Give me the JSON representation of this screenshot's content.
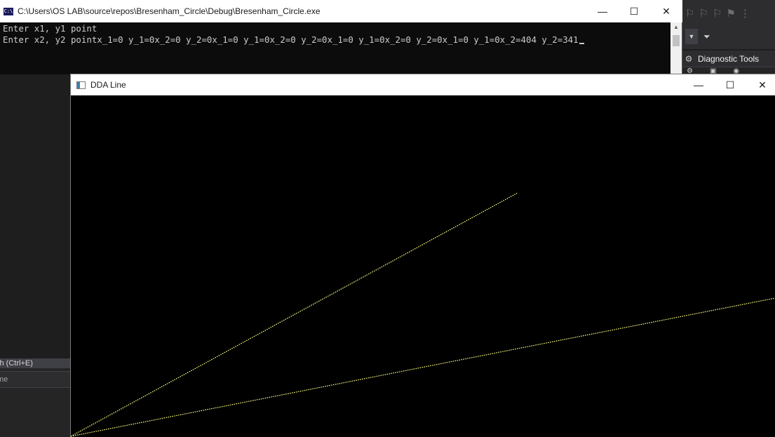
{
  "console_window": {
    "title": "C:\\Users\\OS LAB\\source\\repos\\Bresenham_Circle\\Debug\\Bresenham_Circle.exe",
    "icon_text": "C:\\",
    "lines": [
      "Enter x1, y1 point",
      "Enter x2, y2 pointx_1=0 y_1=0x_2=0 y_2=0x_1=0 y_1=0x_2=0 y_2=0x_1=0 y_1=0x_2=0 y_2=0x_1=0 y_1=0x_2=404 y_2=341"
    ],
    "minimize": "—",
    "maximize": "☐",
    "close": "✕"
  },
  "graphics_window": {
    "title": "DDA Line",
    "minimize": "—",
    "maximize": "☐",
    "close": "✕",
    "line_color": "#ffff80",
    "background_color": "#000000"
  },
  "vs": {
    "panel_title": "Diagnostic Tools",
    "search_label": "ch (Ctrl+E)",
    "column_label": "me"
  }
}
